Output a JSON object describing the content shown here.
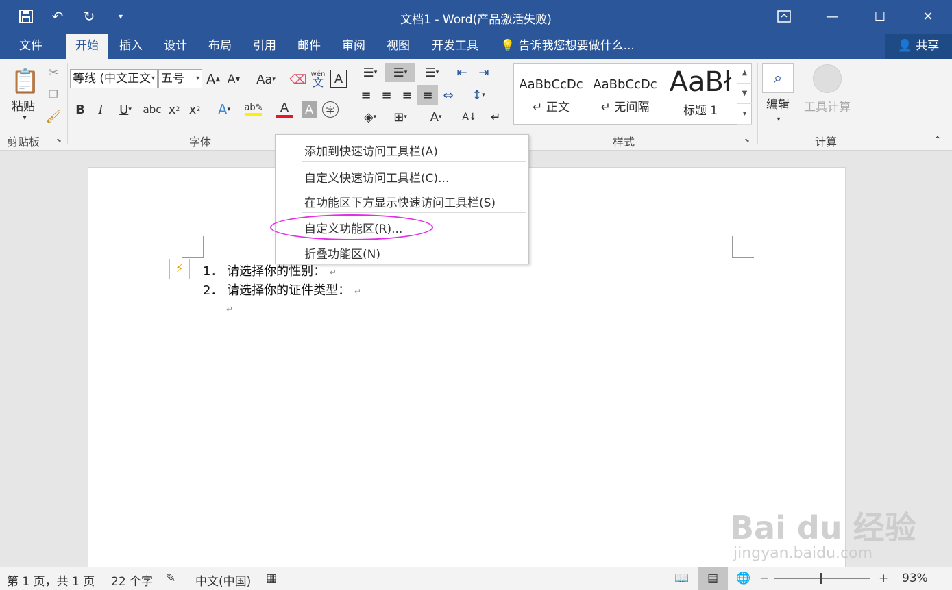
{
  "window": {
    "title": "文档1 - Word(产品激活失败)"
  },
  "tabs": [
    "文件",
    "开始",
    "插入",
    "设计",
    "布局",
    "引用",
    "邮件",
    "审阅",
    "视图",
    "开发工具"
  ],
  "tell_me": "告诉我您想要做什么...",
  "share_label": "共享",
  "ribbon": {
    "clipboard": {
      "paste": "粘贴",
      "label": "剪贴板"
    },
    "font": {
      "name": "等线 (中文正文",
      "size": "五号",
      "label": "字体",
      "case_label": "Aa",
      "phonetic_top": "wén",
      "phonetic_bottom": "文"
    },
    "styles": {
      "label": "样式",
      "items": [
        {
          "preview": "AaBbCcDc",
          "name": "↵ 正文"
        },
        {
          "preview": "AaBbCcDc",
          "name": "↵ 无间隔"
        },
        {
          "preview": "AaBł",
          "name": "标题 1"
        }
      ]
    },
    "editing": {
      "label": "编辑"
    },
    "calc": {
      "tool": "工具计算",
      "label": "计算"
    }
  },
  "context_menu": {
    "items": [
      "添加到快速访问工具栏(A)",
      "自定义快速访问工具栏(C)...",
      "在功能区下方显示快速访问工具栏(S)",
      "自定义功能区(R)...",
      "折叠功能区(N)"
    ]
  },
  "document": {
    "lines": [
      {
        "num": "1．",
        "text": "请选择你的性别："
      },
      {
        "num": "2．",
        "text": "请选择你的证件类型："
      }
    ],
    "para_mark": "↵"
  },
  "status": {
    "page": "第 1 页，共 1 页",
    "words": "22 个字",
    "lang": "中文(中国)",
    "zoom": "93%"
  },
  "watermark": {
    "main": "Bai du 经验",
    "sub": "jingyan.baidu.com"
  },
  "colors": {
    "brand": "#2b579a",
    "highlight": "#e62be6"
  }
}
